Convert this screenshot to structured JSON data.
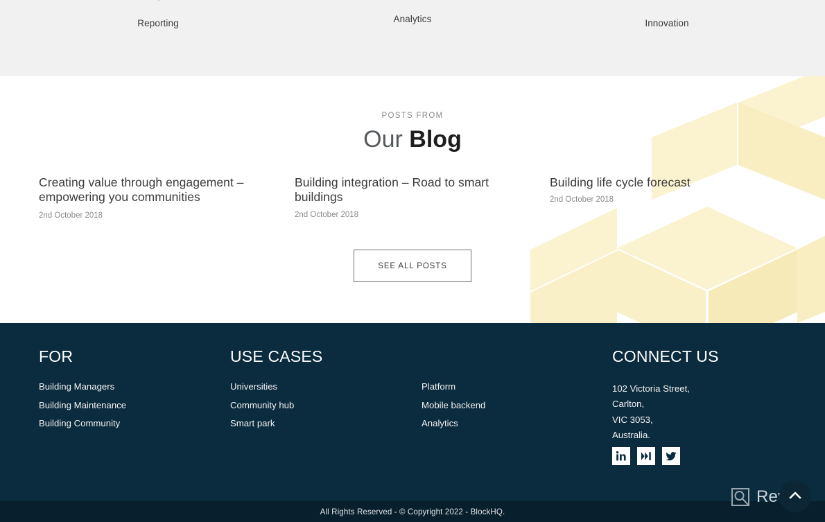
{
  "features": {
    "items": [
      {
        "label": "Reporting",
        "icon": "reporting-chart-icon"
      },
      {
        "label": "Analytics",
        "icon": "analytics-graph-icon"
      },
      {
        "label": "Innovation",
        "icon": "innovation-lightbulb-head-icon"
      }
    ]
  },
  "blog": {
    "eyebrow": "POSTS FROM",
    "title_light": "Our",
    "title_bold": "Blog",
    "posts": [
      {
        "title": "Creating value through engagement – empowering you communities",
        "date": "2nd October 2018"
      },
      {
        "title": "Building integration – Road to smart buildings",
        "date": "2nd October 2018"
      },
      {
        "title": "Building life cycle forecast",
        "date": "2nd October 2018"
      }
    ],
    "see_all_label": "SEE ALL POSTS"
  },
  "footer": {
    "columns": [
      {
        "heading": "FOR",
        "links": [
          "Building Managers",
          "Building Maintenance",
          "Building Community"
        ]
      },
      {
        "heading": "USE CASES",
        "links": [
          "Universities",
          "Community hub",
          "Smart park"
        ]
      },
      {
        "heading": "",
        "links": [
          "Platform",
          "Mobile backend",
          "Analytics"
        ]
      }
    ],
    "connect": {
      "heading": "CONNECT US",
      "address_lines": [
        "102 Victoria Street,",
        "Carlton,",
        "VIC 3053,",
        "Australia."
      ]
    },
    "socials": [
      {
        "name": "linkedin-icon",
        "glyph": "in"
      },
      {
        "name": "medium-icon",
        "glyph": "M"
      },
      {
        "name": "twitter-icon",
        "glyph": "bird"
      }
    ],
    "copyright": "All Rights Reserved - © Copyright 2022 - BlockHQ."
  },
  "overlay": {
    "watermark_text": "Revain",
    "scroll_top_label": "Scroll to top"
  },
  "colors": {
    "features_bg": "#f1f1f1",
    "footer_bg": "#0b2b3e",
    "copyright_bg": "#081f2d",
    "cube_yellow": "#fbf2cf",
    "accent_yellow": "#f7d117",
    "accent_red": "#e03b33",
    "accent_orange": "#f0a92c",
    "accent_blue": "#2e7bbf"
  }
}
